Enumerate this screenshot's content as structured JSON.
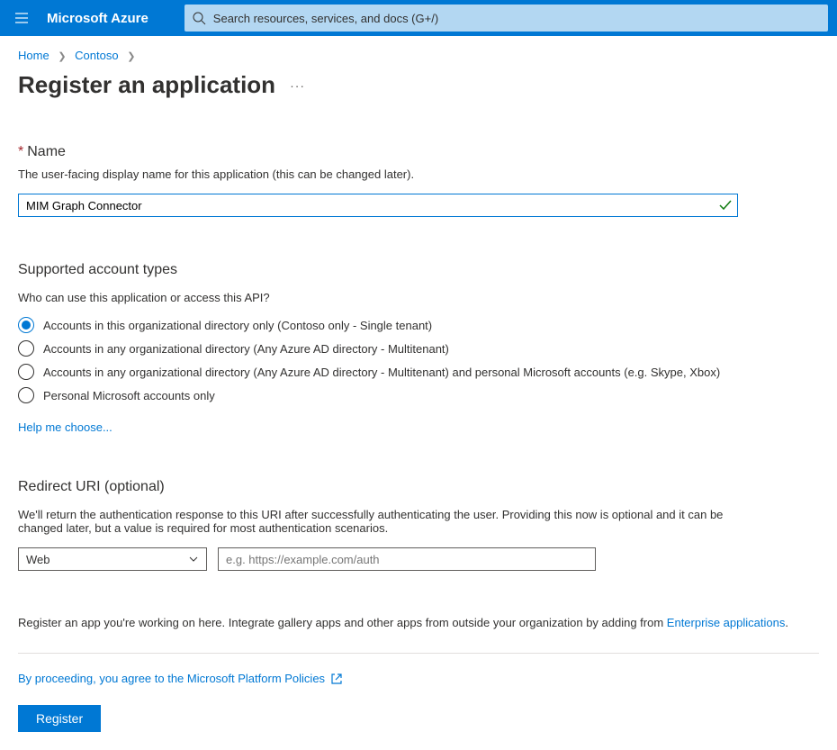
{
  "brand": "Microsoft Azure",
  "search": {
    "placeholder": "Search resources, services, and docs (G+/)"
  },
  "breadcrumbs": {
    "home": "Home",
    "org": "Contoso"
  },
  "page": {
    "title": "Register an application"
  },
  "nameField": {
    "label": "Name",
    "desc": "The user-facing display name for this application (this can be changed later).",
    "value": "MIM Graph Connector"
  },
  "accountTypes": {
    "title": "Supported account types",
    "question": "Who can use this application or access this API?",
    "options": {
      "o1": "Accounts in this organizational directory only (Contoso only - Single tenant)",
      "o2": "Accounts in any organizational directory (Any Azure AD directory - Multitenant)",
      "o3": "Accounts in any organizational directory (Any Azure AD directory - Multitenant) and personal Microsoft accounts (e.g. Skype, Xbox)",
      "o4": "Personal Microsoft accounts only"
    },
    "helpLink": "Help me choose..."
  },
  "redirect": {
    "title": "Redirect URI (optional)",
    "desc": "We'll return the authentication response to this URI after successfully authenticating the user. Providing this now is optional and it can be changed later, but a value is required for most authentication scenarios.",
    "platform": "Web",
    "uriPlaceholder": "e.g. https://example.com/auth"
  },
  "gallery": {
    "prefix": "Register an app you're working on here. Integrate gallery apps and other apps from outside your organization by adding from ",
    "link": "Enterprise applications",
    "suffix": "."
  },
  "agree": {
    "text": "By proceeding, you agree to the Microsoft Platform Policies"
  },
  "registerBtn": "Register"
}
